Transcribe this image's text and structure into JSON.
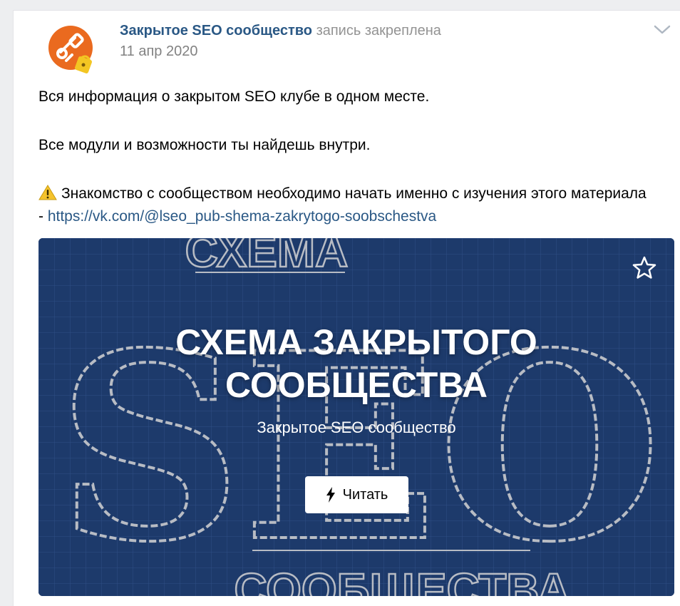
{
  "post": {
    "author": "Закрытое SEO сообщество",
    "pinned_label": "запись закреплена",
    "date": "11 апр 2020",
    "menu_icon": "chevron-down-icon"
  },
  "text": {
    "line1": "Вся информация о закрытом SEO клубе в одном месте.",
    "line2": "Все модули и возможности ты найдешь внутри.",
    "line3": "Знакомство с сообществом необходимо начать именно с изучения этого материала - ",
    "link": "https://vk.com/@lseo_pub-shema-zakrytogo-soobschestva",
    "warning_icon": "warning-icon"
  },
  "article_card": {
    "title_line1": "СХЕМА ЗАКРЫТОГО",
    "title_line2": "СООБЩЕСТВА",
    "subtitle": "Закрытое SEO сообщество",
    "button_label": "Читать",
    "bg_top_word": "СХЕМА",
    "bg_big_word": "SEO",
    "bg_bottom_word": "СООБЩЕСТВА",
    "bg_color": "#1d3a6b"
  },
  "colors": {
    "link": "#2a5885",
    "muted": "#828282",
    "background": "#edeef0"
  }
}
